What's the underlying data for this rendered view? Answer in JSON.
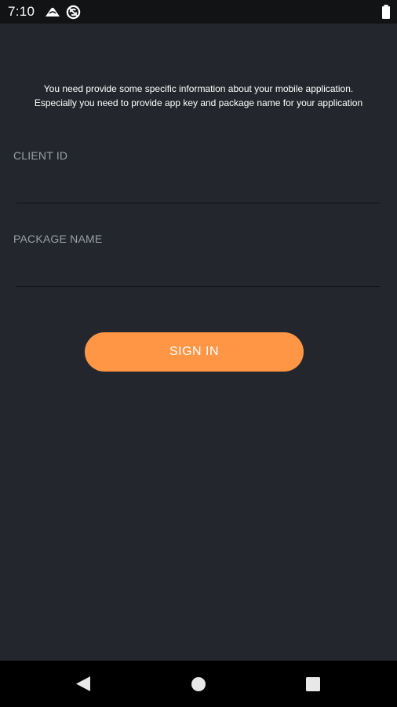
{
  "status_bar": {
    "time": "7:10",
    "icons": [
      "cloud-icon",
      "sync-disabled-icon",
      "battery-icon"
    ]
  },
  "intro": {
    "line1": "You need provide some specific information about your mobile application.",
    "line2": "Especially you need to provide app key and package name for your application"
  },
  "form": {
    "client_id": {
      "label": "CLIENT ID",
      "value": ""
    },
    "package_name": {
      "label": "PACKAGE NAME",
      "value": ""
    },
    "sign_in_label": "SIGN IN"
  },
  "nav_bar": {
    "icons": [
      "back-icon",
      "home-icon",
      "recents-icon"
    ]
  },
  "colors": {
    "background": "#23272d",
    "status_bar": "#111315",
    "accent": "#ff9646",
    "label": "#9aa0a6",
    "nav_bar": "#000000"
  }
}
